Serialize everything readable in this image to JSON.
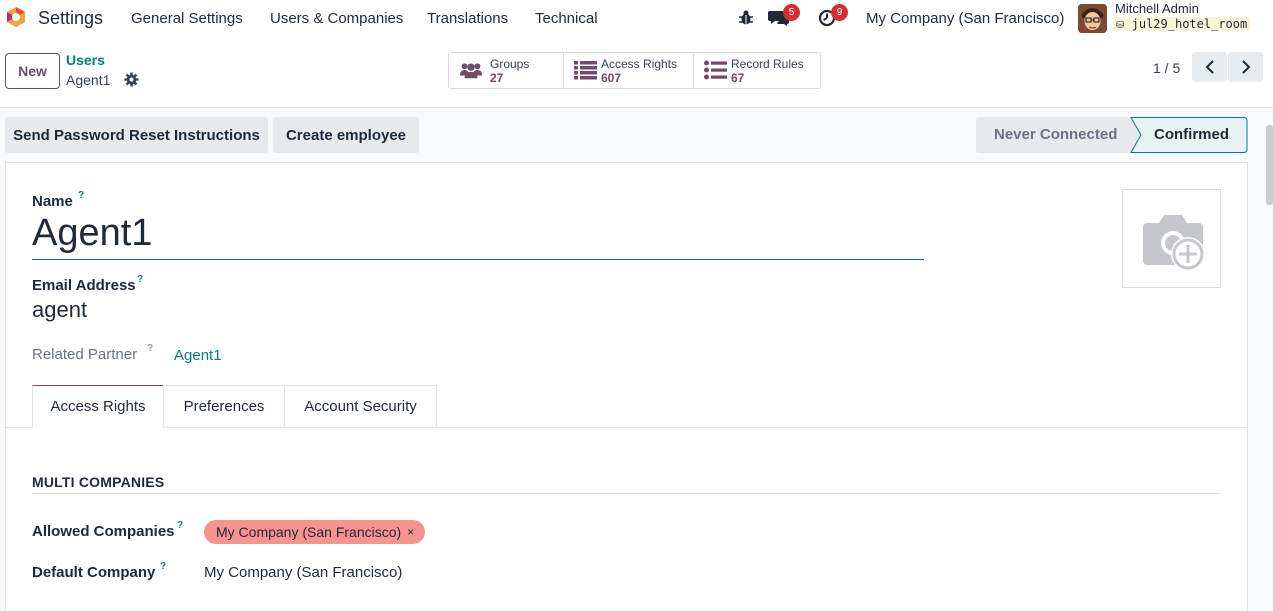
{
  "navbar": {
    "app_title": "Settings",
    "menu": [
      "General Settings",
      "Users & Companies",
      "Translations",
      "Technical"
    ],
    "messages_badge": "5",
    "activities_badge": "9",
    "company": "My Company (San Francisco)",
    "user_name": "Mitchell Admin",
    "database": "jul29_hotel_room"
  },
  "control_panel": {
    "new_label": "New",
    "breadcrumb_parent": "Users",
    "breadcrumb_current": "Agent1",
    "smart_buttons": [
      {
        "label": "Groups",
        "value": "27",
        "icon": "users-icon"
      },
      {
        "label": "Access Rights",
        "value": "607",
        "icon": "list-icon"
      },
      {
        "label": "Record Rules",
        "value": "67",
        "icon": "list-icon"
      }
    ],
    "pager": "1 / 5"
  },
  "actions": {
    "reset_password": "Send Password Reset Instructions",
    "create_employee": "Create employee",
    "status_never": "Never Connected",
    "status_confirmed": "Confirmed"
  },
  "form": {
    "name_label": "Name",
    "name_value": "Agent1",
    "email_label": "Email Address",
    "email_value": "agent",
    "partner_label": "Related Partner",
    "partner_value": "Agent1",
    "help": "?",
    "tabs": [
      "Access Rights",
      "Preferences",
      "Account Security"
    ],
    "section_title": "MULTI COMPANIES",
    "allowed_label": "Allowed Companies",
    "allowed_tag": "My Company (San Francisco)",
    "tag_remove": "×",
    "default_label": "Default Company",
    "default_value": "My Company (San Francisco)"
  },
  "colors": {
    "brand": "#714b67",
    "accent": "#017e84",
    "badge": "#d32f2f",
    "tag": "#f4938f"
  }
}
